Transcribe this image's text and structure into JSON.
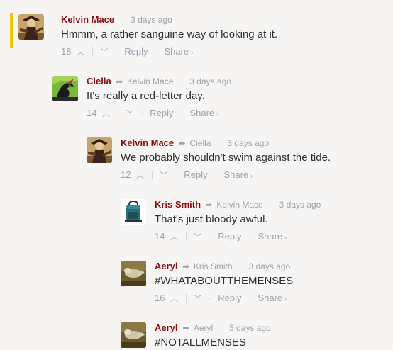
{
  "comments": [
    {
      "author": "Kelvin Mace",
      "reply_to": "",
      "time": "3 days ago",
      "text": "Hmmm, a rather sanguine way of looking at it.",
      "votes": "18",
      "reply_label": "Reply",
      "share_label": "Share",
      "avatar_icon": "robed-figure-icon",
      "highlighted": true
    },
    {
      "author": "Ciella",
      "reply_to": "Kelvin Mace",
      "time": "3 days ago",
      "text": "It's really a red-letter day.",
      "votes": "14",
      "reply_label": "Reply",
      "share_label": "Share",
      "avatar_icon": "dragon-icon"
    },
    {
      "author": "Kelvin Mace",
      "reply_to": "Ciella",
      "time": "3 days ago",
      "text": "We probably shouldn't swim against the tide.",
      "votes": "12",
      "reply_label": "Reply",
      "share_label": "Share",
      "avatar_icon": "robed-figure-icon"
    },
    {
      "author": "Kris Smith",
      "reply_to": "Kelvin Mace",
      "time": "3 days ago",
      "text": "That's just bloody awful.",
      "votes": "14",
      "reply_label": "Reply",
      "share_label": "Share",
      "avatar_icon": "backpack-icon"
    },
    {
      "author": "Aeryl",
      "reply_to": "Kris Smith",
      "time": "3 days ago",
      "text": "#WHATABOUTTHEMENSES",
      "votes": "16",
      "reply_label": "Reply",
      "share_label": "Share",
      "avatar_icon": "creature-icon"
    },
    {
      "author": "Aeryl",
      "reply_to": "Aeryl",
      "time": "3 days ago",
      "text": "#NOTALLMENSES",
      "avatar_icon": "creature-icon"
    }
  ],
  "colors": {
    "author": "#8a1010",
    "meta": "#9aa3ad",
    "highlight": "#f1c40f",
    "background": "#f7f5f3"
  }
}
